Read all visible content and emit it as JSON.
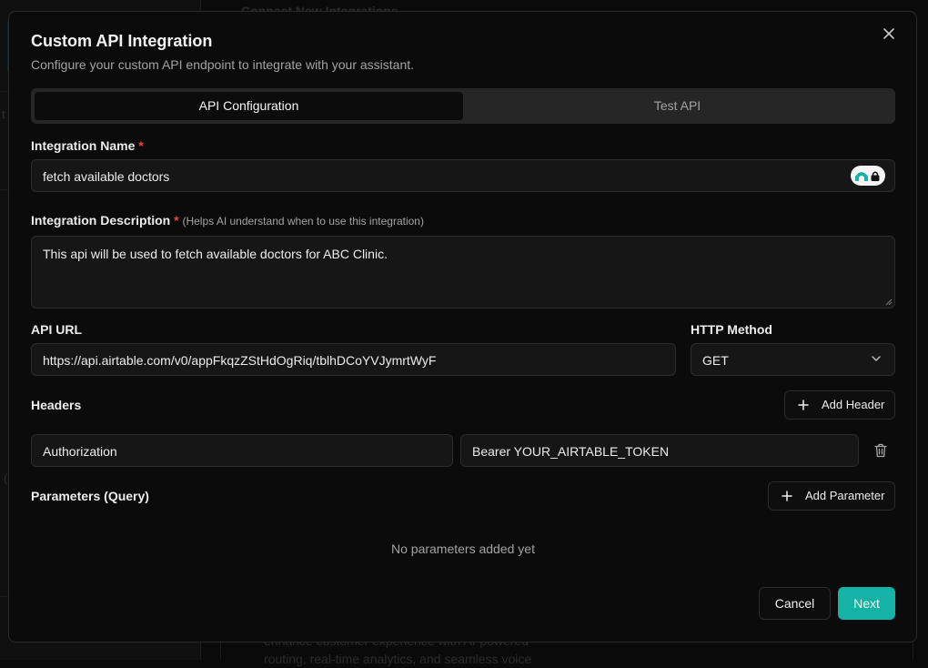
{
  "background": {
    "main_title": "Connect New Integrations",
    "bottom_text": "enhance customer experience with AI-powered routing, real-time analytics, and seamless voice",
    "sidebar_fragments": [
      "t",
      "("
    ]
  },
  "modal": {
    "title": "Custom API Integration",
    "subtitle": "Configure your custom API endpoint to integrate with your assistant.",
    "close_icon": "close-icon"
  },
  "tabs": [
    {
      "label": "API Configuration",
      "active": true
    },
    {
      "label": "Test API",
      "active": false
    }
  ],
  "form": {
    "integration_name": {
      "label": "Integration Name",
      "required_mark": "*",
      "value": "fetch available doctors",
      "badge_icon": "password-manager-icon"
    },
    "integration_description": {
      "label": "Integration Description",
      "required_mark": "*",
      "hint": "(Helps AI understand when to use this integration)",
      "value": "This api will be used to fetch available doctors for ABC Clinic."
    },
    "api_url": {
      "label": "API URL",
      "value": "https://api.airtable.com/v0/appFkqzZStHdOgRiq/tblhDCoYVJymrtWyF"
    },
    "http_method": {
      "label": "HTTP Method",
      "value": "GET"
    },
    "headers": {
      "label": "Headers",
      "add_label": "Add Header",
      "items": [
        {
          "key": "Authorization",
          "value": "Bearer YOUR_AIRTABLE_TOKEN"
        }
      ]
    },
    "parameters": {
      "label": "Parameters (Query)",
      "add_label": "Add Parameter",
      "empty_text": "No parameters added yet"
    }
  },
  "footer": {
    "cancel_label": "Cancel",
    "next_label": "Next"
  },
  "colors": {
    "accent": "#14b3a6",
    "required": "#ef4444",
    "modal_bg": "#0b0b0b",
    "input_bg": "#161616"
  }
}
